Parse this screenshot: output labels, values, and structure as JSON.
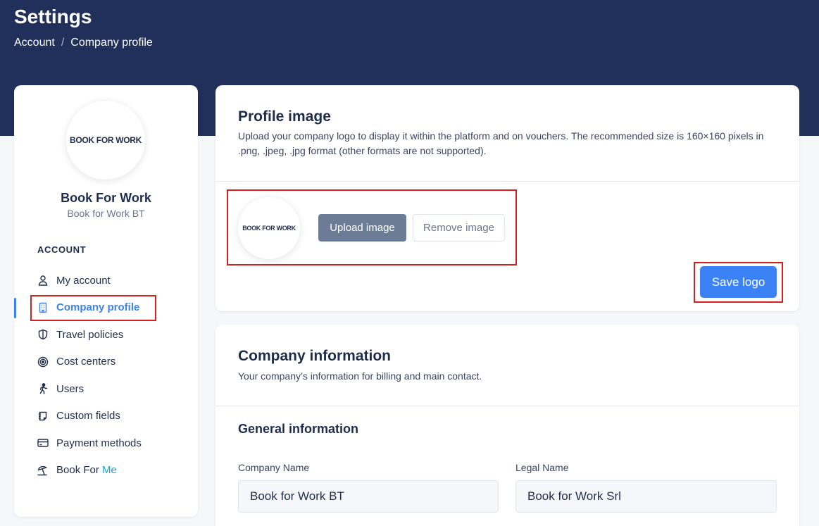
{
  "header": {
    "title": "Settings",
    "breadcrumb": [
      "Account",
      "Company profile"
    ],
    "separator": "/"
  },
  "sidebar": {
    "logo_text": "BOOK FOR WORK",
    "company_name": "Book For Work",
    "company_sub": "Book for Work BT",
    "section_label": "ACCOUNT",
    "items": [
      {
        "label": "My account",
        "icon": "user-icon"
      },
      {
        "label": "Company profile",
        "icon": "building-icon"
      },
      {
        "label": "Travel policies",
        "icon": "shield-icon"
      },
      {
        "label": "Cost centers",
        "icon": "target-icon"
      },
      {
        "label": "Users",
        "icon": "walking-person-icon"
      },
      {
        "label": "Custom fields",
        "icon": "note-icon"
      },
      {
        "label": "Payment methods",
        "icon": "credit-card-icon"
      },
      {
        "label": "Book For",
        "label_accent": "Me",
        "icon": "beach-umbrella-icon"
      }
    ]
  },
  "profile_image": {
    "title": "Profile image",
    "description": "Upload your company logo to display it within the platform and on vouchers. The recommended size is 160×160 pixels in .png, .jpeg, .jpg format (other formats are not supported).",
    "upload_label": "Upload image",
    "remove_label": "Remove image",
    "save_label": "Save logo"
  },
  "company_info": {
    "title": "Company information",
    "description": "Your company’s information for billing and main contact.",
    "subsection": "General information",
    "fields": {
      "company_name_label": "Company Name",
      "company_name_value": "Book for Work BT",
      "legal_name_label": "Legal Name",
      "legal_name_value": "Book for Work Srl"
    }
  },
  "colors": {
    "header_bg": "#20305a",
    "accent": "#3b82f6",
    "highlight": "#d81e1e"
  }
}
